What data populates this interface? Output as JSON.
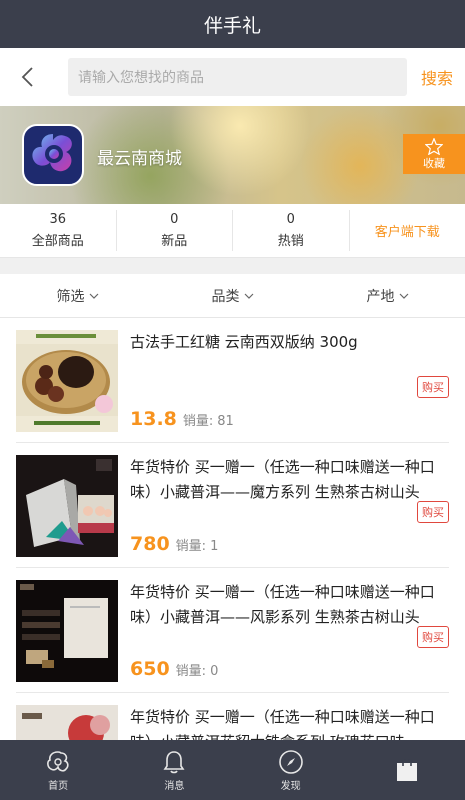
{
  "header": {
    "title": "伴手礼"
  },
  "search": {
    "placeholder": "请输入您想找的商品",
    "button_label": "搜索"
  },
  "shop": {
    "name": "最云南商城",
    "favorite_label": "收藏"
  },
  "stats": [
    {
      "count": "36",
      "label": "全部商品"
    },
    {
      "count": "0",
      "label": "新品"
    },
    {
      "count": "0",
      "label": "热销"
    }
  ],
  "download_label": "客户端下载",
  "filters": [
    "筛选",
    "品类",
    "产地"
  ],
  "products": [
    {
      "title": "古法手工红糖 云南西双版纳 300g",
      "price": "13.8",
      "sales_label": "销量:",
      "sales": "81",
      "buy_label": "购买"
    },
    {
      "title": "年货特价 买一赠一（任选一种口味赠送一种口味）小藏普洱——魔方系列 生熟茶古树山头",
      "price": "780",
      "sales_label": "销量:",
      "sales": "1",
      "buy_label": "购买"
    },
    {
      "title": "年货特价 买一赠一（任选一种口味赠送一种口味）小藏普洱——风影系列 生熟茶古树山头",
      "price": "650",
      "sales_label": "销量:",
      "sales": "0",
      "buy_label": "购买"
    },
    {
      "title": "年货特价 买一赠一（任选一种口味赠送一种口味）小藏普洱花貂大铁盒系列 玫瑰花口味",
      "price": "",
      "sales_label": "",
      "sales": "",
      "buy_label": ""
    }
  ],
  "tabs": [
    {
      "label": "首页",
      "icon": "home-icon"
    },
    {
      "label": "消息",
      "icon": "bell-icon"
    },
    {
      "label": "发现",
      "icon": "compass-icon"
    },
    {
      "label": "",
      "icon": "shopping-bag-icon"
    }
  ],
  "colors": {
    "accent": "#f7931e",
    "header_bg": "#3b3f4c",
    "buy_red": "#e0483e",
    "active_tab": "#9b3fc8"
  }
}
